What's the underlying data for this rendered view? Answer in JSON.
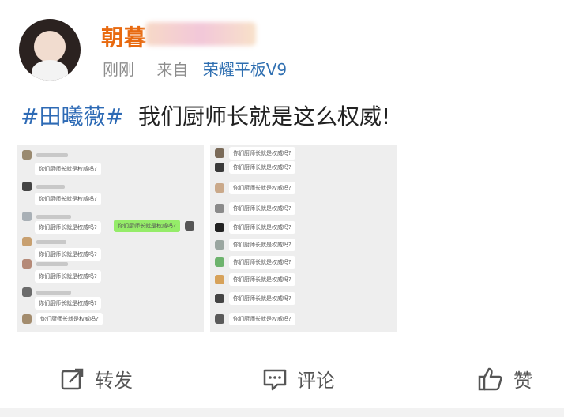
{
  "post": {
    "username": "朝暮",
    "time": "刚刚",
    "source_prefix": "来自",
    "device": "荣耀平板V9",
    "hashtag": "#田曦薇#",
    "text": "我们厨师长就是这么权威!"
  },
  "actions": {
    "repost_label": "转发",
    "comment_label": "评论",
    "like_label": "赞"
  },
  "icons": [
    "repost-icon",
    "comment-icon",
    "like-icon"
  ]
}
